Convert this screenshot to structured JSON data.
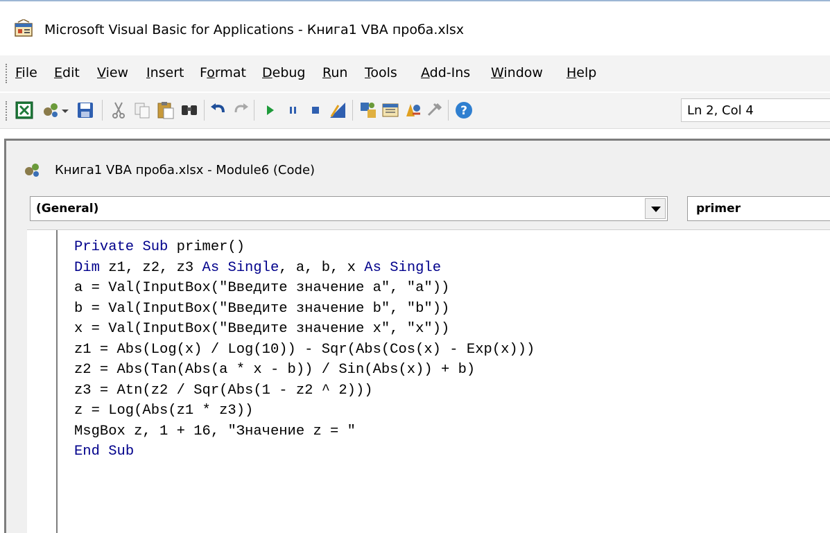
{
  "window": {
    "title": "Microsoft Visual Basic for Applications - Книга1 VBA проба.xlsx"
  },
  "menu": {
    "items": [
      "File",
      "Edit",
      "View",
      "Insert",
      "Format",
      "Debug",
      "Run",
      "Tools",
      "Add-Ins",
      "Window",
      "Help"
    ]
  },
  "toolbar": {
    "position_label": "Ln 2, Col 4",
    "icons": [
      "view-excel-icon",
      "insert-module-icon",
      "save-icon",
      "cut-icon",
      "copy-icon",
      "paste-icon",
      "find-icon",
      "undo-icon",
      "redo-icon",
      "run-icon",
      "break-icon",
      "reset-icon",
      "design-mode-icon",
      "project-explorer-icon",
      "properties-window-icon",
      "object-browser-icon",
      "toolbox-icon",
      "help-icon"
    ]
  },
  "code_window": {
    "title": "Книга1 VBA проба.xlsx - Module6 (Code)",
    "object_combo": "(General)",
    "procedure_combo": "primer",
    "lines": [
      "Private Sub primer()",
      "Dim z1, z2, z3 As Single, a, b, x As Single",
      "a = Val(InputBox(\"Введите значение a\", \"a\"))",
      "b = Val(InputBox(\"Введите значение b\", \"b\"))",
      "x = Val(InputBox(\"Введите значение x\", \"x\"))",
      "z1 = Abs(Log(x) / Log(10)) - Sqr(Abs(Cos(x) - Exp(x)))",
      "z2 = Abs(Tan(Abs(a * x - b)) / Sin(Abs(x)) + b)",
      "z3 = Atn(z2 / Sqr(Abs(1 - z2 ^ 2)))",
      "z = Log(Abs(z1 * z3))",
      "MsgBox z, 1 + 16, \"Значение z = \"",
      "End Sub"
    ]
  },
  "colors": {
    "keyword": "#00008b",
    "text": "#000000"
  }
}
